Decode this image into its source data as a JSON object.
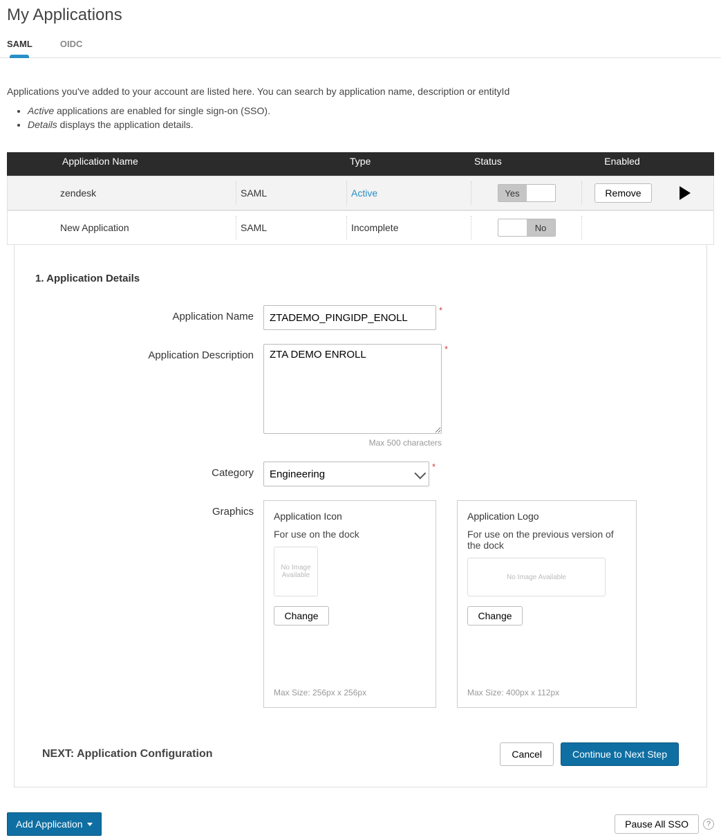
{
  "header": {
    "title": "My Applications",
    "tabs": [
      {
        "label": "SAML",
        "active": true
      },
      {
        "label": "OIDC",
        "active": false
      }
    ]
  },
  "intro": {
    "text": "Applications you've added to your account are listed here. You can search by application name, description or entityId",
    "bullets": [
      {
        "em": "Active",
        "rest": " applications are enabled for single sign-on (SSO)."
      },
      {
        "em": "Details",
        "rest": " displays the application details."
      }
    ]
  },
  "table": {
    "headers": {
      "name": "Application Name",
      "type": "Type",
      "status": "Status",
      "enabled": "Enabled"
    },
    "rows": [
      {
        "name": "zendesk",
        "type": "SAML",
        "status": "Active",
        "status_class": "active",
        "enabled": "Yes",
        "remove_label": "Remove",
        "selected": true
      },
      {
        "name": "New Application",
        "type": "SAML",
        "status": "Incomplete",
        "status_class": "",
        "enabled": "No",
        "remove_label": "",
        "selected": false
      }
    ]
  },
  "details": {
    "section_title": "1. Application Details",
    "fields": {
      "name_label": "Application Name",
      "name_value": "ZTADEMO_PINGIDP_ENOLL",
      "desc_label": "Application Description",
      "desc_value": "ZTA DEMO ENROLL",
      "desc_hint": "Max 500 characters",
      "category_label": "Category",
      "category_value": "Engineering",
      "graphics_label": "Graphics"
    },
    "graphics": {
      "icon": {
        "title": "Application Icon",
        "sub": "For use on the dock",
        "noimg": "No Image Available",
        "change": "Change",
        "hint": "Max Size: 256px x 256px"
      },
      "logo": {
        "title": "Application Logo",
        "sub": "For use on the previous version of the dock",
        "noimg": "No Image Available",
        "change": "Change",
        "hint": "Max Size: 400px x 112px"
      }
    },
    "footer": {
      "next_label": "NEXT: Application Configuration",
      "cancel": "Cancel",
      "continue": "Continue to Next Step"
    }
  },
  "bottom": {
    "add_application": "Add Application",
    "pause_sso": "Pause All SSO"
  }
}
